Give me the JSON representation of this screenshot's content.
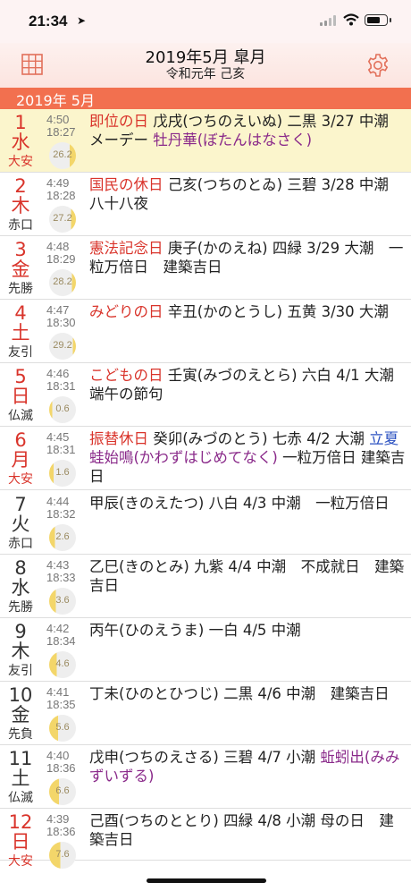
{
  "status": {
    "time": "21:34"
  },
  "header": {
    "title": "2019年5月 皐月",
    "subtitle": "令和元年 己亥"
  },
  "section": {
    "label": "2019年 5月"
  },
  "days": [
    {
      "day": "1",
      "weekday": "水",
      "rokuyo": "大安",
      "sunrise": "4:50",
      "sunset": "18:27",
      "moon_age": "26.2",
      "line1": [
        {
          "t": "即位の日",
          "c": "hol"
        },
        {
          "t": " 戊戌(つちのえいぬ) 二黒 3/27 中潮",
          "c": ""
        }
      ],
      "line2": [
        {
          "t": "メーデー ",
          "c": ""
        },
        {
          "t": "牡丹華(ぼたんはなさく)",
          "c": "purple"
        }
      ]
    },
    {
      "day": "2",
      "weekday": "木",
      "rokuyo": "赤口",
      "sunrise": "4:49",
      "sunset": "18:28",
      "moon_age": "27.2",
      "line1": [
        {
          "t": "国民の休日",
          "c": "hol"
        },
        {
          "t": " 己亥(つちのとゐ) 三碧 3/28 中潮",
          "c": ""
        }
      ],
      "line2": [
        {
          "t": "八十八夜",
          "c": ""
        }
      ]
    },
    {
      "day": "3",
      "weekday": "金",
      "rokuyo": "先勝",
      "sunrise": "4:48",
      "sunset": "18:29",
      "moon_age": "28.2",
      "line1": [
        {
          "t": "憲法記念日",
          "c": "hol"
        },
        {
          "t": " 庚子(かのえね) 四緑 3/29 大潮　一",
          "c": ""
        }
      ],
      "line2": [
        {
          "t": "粒万倍日　建築吉日",
          "c": ""
        }
      ]
    },
    {
      "day": "4",
      "weekday": "土",
      "rokuyo": "友引",
      "sunrise": "4:47",
      "sunset": "18:30",
      "moon_age": "29.2",
      "line1": [
        {
          "t": "みどりの日",
          "c": "hol"
        },
        {
          "t": " 辛丑(かのとうし) 五黄 3/30 大潮",
          "c": ""
        }
      ],
      "line2": []
    },
    {
      "day": "5",
      "weekday": "日",
      "rokuyo": "仏滅",
      "sunrise": "4:46",
      "sunset": "18:31",
      "moon_age": "0.6",
      "line1": [
        {
          "t": "こどもの日",
          "c": "hol"
        },
        {
          "t": " 壬寅(みづのえとら) 六白 4/1 大潮",
          "c": ""
        }
      ],
      "line2": [
        {
          "t": "端午の節句",
          "c": ""
        }
      ]
    },
    {
      "day": "6",
      "weekday": "月",
      "rokuyo": "大安",
      "sunrise": "4:45",
      "sunset": "18:31",
      "moon_age": "1.6",
      "line1": [
        {
          "t": "振替休日",
          "c": "hol"
        },
        {
          "t": " 癸卯(みづのとう) 七赤 4/2 大潮 ",
          "c": ""
        },
        {
          "t": "立夏",
          "c": "blue"
        }
      ],
      "line2": [
        {
          "t": "蛙始鳴(かわずはじめてなく)",
          "c": "purple"
        },
        {
          "t": " 一粒万倍日 建築吉",
          "c": ""
        }
      ],
      "line3": [
        {
          "t": "日",
          "c": ""
        }
      ]
    },
    {
      "day": "7",
      "weekday": "火",
      "rokuyo": "赤口",
      "sunrise": "4:44",
      "sunset": "18:32",
      "moon_age": "2.6",
      "line1": [
        {
          "t": "甲辰(きのえたつ) 八白 4/3 中潮　一粒万倍日",
          "c": ""
        }
      ],
      "line2": []
    },
    {
      "day": "8",
      "weekday": "水",
      "rokuyo": "先勝",
      "sunrise": "4:43",
      "sunset": "18:33",
      "moon_age": "3.6",
      "line1": [
        {
          "t": "乙巳(きのとみ) 九紫 4/4 中潮　不成就日　建築",
          "c": ""
        }
      ],
      "line2": [
        {
          "t": "吉日",
          "c": ""
        }
      ]
    },
    {
      "day": "9",
      "weekday": "木",
      "rokuyo": "友引",
      "sunrise": "4:42",
      "sunset": "18:34",
      "moon_age": "4.6",
      "line1": [
        {
          "t": "丙午(ひのえうま) 一白 4/5 中潮",
          "c": ""
        }
      ],
      "line2": []
    },
    {
      "day": "10",
      "weekday": "金",
      "rokuyo": "先負",
      "sunrise": "4:41",
      "sunset": "18:35",
      "moon_age": "5.6",
      "line1": [
        {
          "t": "丁未(ひのとひつじ) 二黒 4/6 中潮　建築吉日",
          "c": ""
        }
      ],
      "line2": []
    },
    {
      "day": "11",
      "weekday": "土",
      "rokuyo": "仏滅",
      "sunrise": "4:40",
      "sunset": "18:36",
      "moon_age": "6.6",
      "line1": [
        {
          "t": "戊申(つちのえさる) 三碧 4/7 小潮 ",
          "c": ""
        },
        {
          "t": "蚯蚓出(みみ",
          "c": "purple"
        }
      ],
      "line2": [
        {
          "t": "ずいずる)",
          "c": "purple"
        }
      ]
    },
    {
      "day": "12",
      "weekday": "日",
      "rokuyo": "大安",
      "sunrise": "4:39",
      "sunset": "18:36",
      "moon_age": "7.6",
      "line1": [
        {
          "t": "己酉(つちのととり) 四緑 4/8 小潮 母の日　建",
          "c": ""
        }
      ],
      "line2": [
        {
          "t": "築吉日",
          "c": ""
        }
      ]
    }
  ],
  "colors": {
    "accent": "#f2704f",
    "holiday": "#d9342b",
    "highlight_row": "#fbf5cc",
    "sekki_blue": "#2a50c0",
    "kou_purple": "#8a2a8a"
  }
}
